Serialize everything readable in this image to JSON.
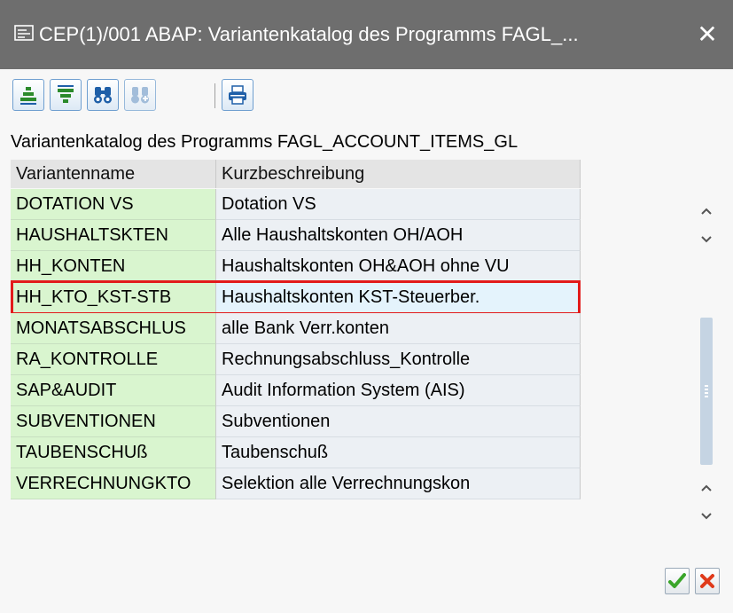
{
  "window": {
    "title": "CEP(1)/001 ABAP: Variantenkatalog des Programms FAGL_...",
    "close_symbol": "✕"
  },
  "toolbar": {
    "icons": [
      "sort-ascending-icon",
      "sort-descending-icon",
      "find-icon",
      "find-next-icon",
      "print-icon"
    ]
  },
  "caption": "Variantenkatalog des Programms FAGL_ACCOUNT_ITEMS_GL",
  "table": {
    "columns": [
      "Variantenname",
      "Kurzbeschreibung"
    ],
    "rows": [
      {
        "name": "DOTATION VS",
        "desc": "Dotation VS"
      },
      {
        "name": "HAUSHALTSKTEN",
        "desc": "Alle Haushaltskonten OH/AOH"
      },
      {
        "name": "HH_KONTEN",
        "desc": "Haushaltskonten OH&AOH ohne VU"
      },
      {
        "name": "HH_KTO_KST-STB",
        "desc": "Haushaltskonten KST-Steuerber."
      },
      {
        "name": "MONATSABSCHLUS",
        "desc": "alle Bank Verr.konten"
      },
      {
        "name": "RA_KONTROLLE",
        "desc": "Rechnungsabschluss_Kontrolle"
      },
      {
        "name": "SAP&AUDIT",
        "desc": "Audit Information System (AIS)"
      },
      {
        "name": "SUBVENTIONEN",
        "desc": "Subventionen"
      },
      {
        "name": "TAUBENSCHUß",
        "desc": "Taubenschuß"
      },
      {
        "name": "VERRECHNUNGKTO",
        "desc": "Selektion alle Verrechnungskon"
      }
    ],
    "selected_row": 3
  },
  "colors": {
    "name_column_bg": "#d9f5cf",
    "desc_column_bg": "#ecf0f4",
    "highlight_border": "#e21b1b",
    "title_bar": "#6e6e6e",
    "confirm_icon": "#3aa52a",
    "cancel_icon": "#e03a1a"
  }
}
